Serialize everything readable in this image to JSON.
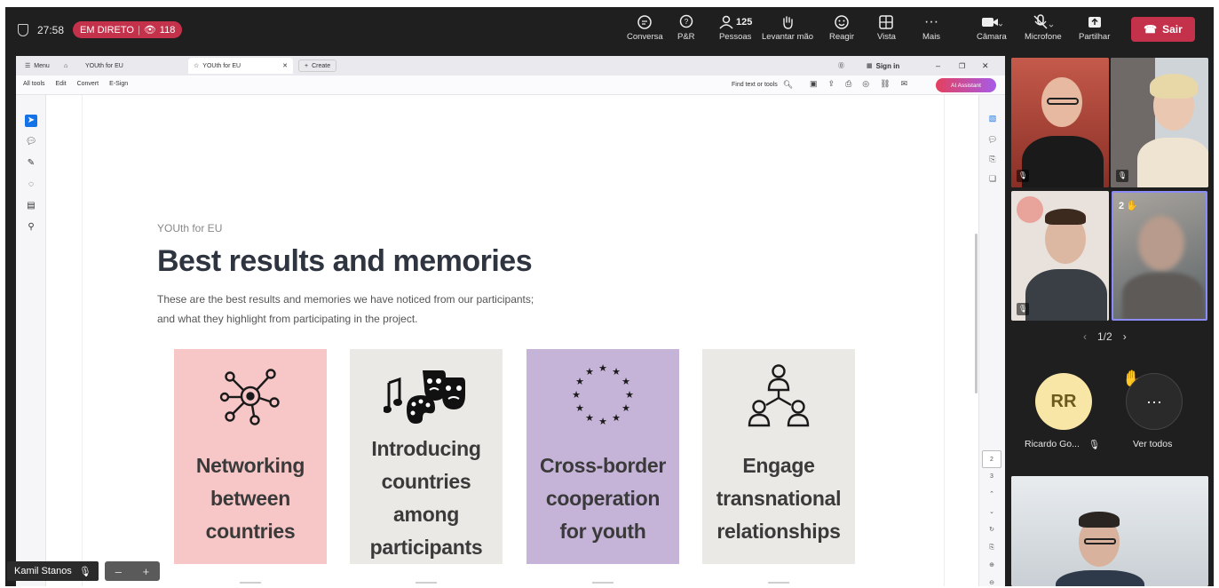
{
  "meeting": {
    "timer": "27:58",
    "live_label": "EM DIRETO",
    "viewers": "118",
    "participants_count": "125"
  },
  "controls": [
    {
      "label": "Conversa",
      "icon": "chat-icon"
    },
    {
      "label": "P&R",
      "icon": "qa-icon"
    },
    {
      "label": "Pessoas",
      "icon": "people-icon"
    },
    {
      "label": "Levantar mão",
      "icon": "raise-hand-icon"
    },
    {
      "label": "Reagir",
      "icon": "smile-icon"
    },
    {
      "label": "Vista",
      "icon": "grid-icon"
    },
    {
      "label": "Mais",
      "icon": "more-icon"
    },
    {
      "label": "Câmara",
      "icon": "camera-icon"
    },
    {
      "label": "Microfone",
      "icon": "mic-muted-icon"
    },
    {
      "label": "Partilhar",
      "icon": "share-icon"
    }
  ],
  "leave_label": "Sair",
  "browser": {
    "tabs": [
      "Menu",
      "YOUth for EU",
      "YOUth for EU",
      "Create"
    ],
    "menu": [
      "All tools",
      "Edit",
      "Convert",
      "E-Sign"
    ],
    "sign_in": "Sign in",
    "find_placeholder": "Find text or tools",
    "ai_assistant": "AI Assistant"
  },
  "document": {
    "kicker": "YOUth for EU",
    "title": "Best results and memories",
    "intro_line1": "These are the best results and memories we have noticed from our participants;",
    "intro_line2": "and what they highlight from participating in the project.",
    "cards": [
      {
        "label": "Networking between countries",
        "bg": "#f7c6c7",
        "icon": "network-icon"
      },
      {
        "label": "Introducing countries among participants",
        "bg": "#ebe9e6",
        "icon": "culture-icon"
      },
      {
        "label": "Cross-border cooperation for youth",
        "bg": "#c6b3d8",
        "icon": "eu-stars-icon"
      },
      {
        "label": "Engage transnational relationships",
        "bg": "#ebe9e6",
        "icon": "people-network-icon"
      }
    ],
    "pages": [
      "2",
      "3"
    ]
  },
  "presenter": {
    "name": "Kamil Stanos"
  },
  "gallery": {
    "page": "1/2",
    "raised_count": "2",
    "rr_initials": "RR",
    "rr_name": "Ricardo Go...",
    "see_all": "Ver todos"
  }
}
